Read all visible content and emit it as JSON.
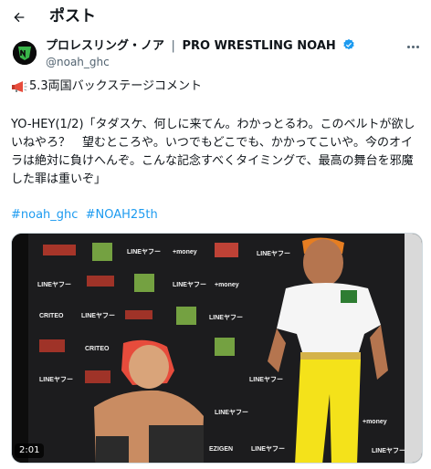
{
  "header": {
    "title": "ポスト"
  },
  "author": {
    "display_name": "プロレスリング・ノア",
    "separator": "|",
    "org_name": "PRO WRESTLING NOAH",
    "handle": "@noah_ghc",
    "verified_color": "#1d9bf0"
  },
  "post": {
    "headline": "5.3両国バックステージコメント",
    "body": "YO-HEY(1/2)「タダスケ、何しに来てん。わかっとるわ。このベルトが欲しいねやろ？　望むところや。いつでもどこでも、かかってこいや。今のオイラは絶対に負けへんぞ。こんな記念すべくタイミングで、最高の舞台を邪魔した罪は重いぞ」",
    "hashtags": [
      "#noah_ghc",
      "#NOAH25th"
    ]
  },
  "video": {
    "duration": "2:01",
    "backdrop_logos": [
      "LINEヤフー",
      "+money",
      "CRITEO",
      "EZIGEN"
    ]
  },
  "colors": {
    "accent": "#1d9bf0",
    "muted": "#536471",
    "text": "#0f1419"
  }
}
